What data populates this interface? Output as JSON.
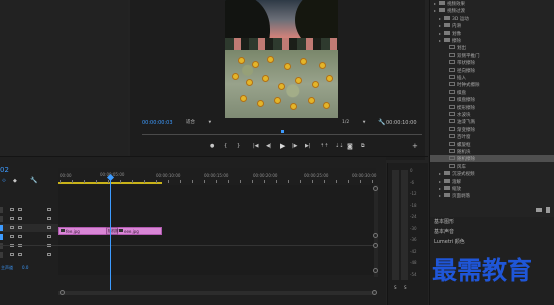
{
  "program_monitor": {
    "timecode_current": "00:00:00:03",
    "fit_label": "适合",
    "quality_label": "1/2",
    "timecode_end": "00:00:10:00"
  },
  "effects_tree": {
    "items": [
      {
        "label": "视频效果",
        "type": "folder",
        "indent": 0
      },
      {
        "label": "视频过渡",
        "type": "folder",
        "indent": 0
      },
      {
        "label": "3D 运动",
        "type": "folder",
        "indent": 1
      },
      {
        "label": "内滑",
        "type": "folder",
        "indent": 1
      },
      {
        "label": "划像",
        "type": "folder",
        "indent": 1
      },
      {
        "label": "擦除",
        "type": "folder",
        "indent": 1
      },
      {
        "label": "划出",
        "type": "item",
        "indent": 2
      },
      {
        "label": "双侧平推门",
        "type": "item",
        "indent": 2
      },
      {
        "label": "带状擦除",
        "type": "item",
        "indent": 2
      },
      {
        "label": "径向擦除",
        "type": "item",
        "indent": 2
      },
      {
        "label": "插入",
        "type": "item",
        "indent": 2
      },
      {
        "label": "时钟式擦除",
        "type": "item",
        "indent": 2
      },
      {
        "label": "棋盘",
        "type": "item",
        "indent": 2
      },
      {
        "label": "棋盘擦除",
        "type": "item",
        "indent": 2
      },
      {
        "label": "楔形擦除",
        "type": "item",
        "indent": 2
      },
      {
        "label": "水波块",
        "type": "item",
        "indent": 2
      },
      {
        "label": "油漆飞溅",
        "type": "item",
        "indent": 2
      },
      {
        "label": "渐变擦除",
        "type": "item",
        "indent": 2
      },
      {
        "label": "百叶窗",
        "type": "item",
        "indent": 2
      },
      {
        "label": "螺旋框",
        "type": "item",
        "indent": 2
      },
      {
        "label": "随机块",
        "type": "item",
        "indent": 2
      },
      {
        "label": "随机擦除",
        "type": "item",
        "indent": 2,
        "selected": true
      },
      {
        "label": "风车",
        "type": "item",
        "indent": 2
      },
      {
        "label": "沉浸式视频",
        "type": "folder",
        "indent": 1
      },
      {
        "label": "溶解",
        "type": "folder",
        "indent": 1
      },
      {
        "label": "缩放",
        "type": "folder",
        "indent": 1
      },
      {
        "label": "页面剥落",
        "type": "folder",
        "indent": 1
      }
    ],
    "tail_links": [
      "基本图形",
      "基本声音",
      "Lumetri 颜色"
    ]
  },
  "timeline": {
    "tab_short": "02",
    "playhead_time": "00:00:05:00",
    "ruler_labels": [
      "00:00",
      "00:00:05:00",
      "00:00:10:00",
      "00:00:15:00",
      "00:00:20:00",
      "00:00:25:00",
      "00:00:30:00",
      "00:00:35:00",
      "00:00:40:00",
      "00:00:45:00"
    ],
    "tracks": [
      {
        "name": "V3",
        "kind": "video"
      },
      {
        "name": "V2",
        "kind": "video"
      },
      {
        "name": "V1",
        "kind": "video"
      },
      {
        "name": "A1",
        "kind": "audio"
      },
      {
        "name": "A2",
        "kind": "audio"
      },
      {
        "name": "A3",
        "kind": "audio"
      },
      {
        "name": "主声道",
        "kind": "master",
        "value": "0.0"
      }
    ],
    "clips": [
      {
        "label": "fee.jpg",
        "track": "V1"
      },
      {
        "label": "eee.jpg",
        "track": "V1"
      }
    ],
    "transition_label": "随机擦"
  },
  "audio_meter": {
    "ticks": [
      "0",
      "-6",
      "-12",
      "-18",
      "-24",
      "-30",
      "-36",
      "-42",
      "-48",
      "-54"
    ],
    "channels": [
      "S",
      "S"
    ]
  },
  "watermark_text": "最需教育"
}
